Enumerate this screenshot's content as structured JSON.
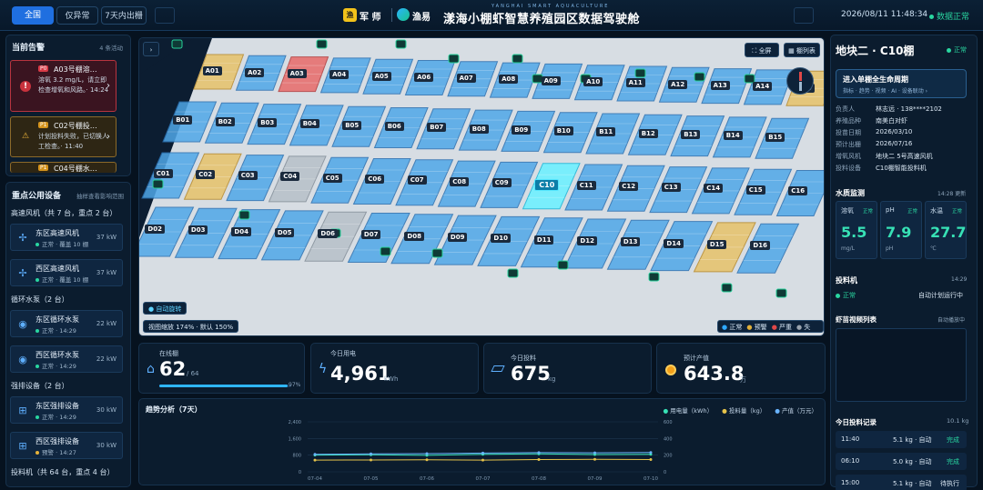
{
  "header": {
    "tabs": [
      "全国",
      "仅异常",
      "7天内出栅"
    ],
    "brand_left": "军 师",
    "brand_logo_char": "渔",
    "brand_right": "渔易",
    "title": "漾海小棚虾智慧养殖园区数据驾驶舱",
    "subtitle": "YANGHAI SMART AQUACULTURE",
    "datetime": "2026/08/11 11:48:34",
    "online": "数据正常"
  },
  "alerts": {
    "title": "当前告警",
    "count": "4 条活动",
    "items": [
      {
        "tag": "P0",
        "title": "A03号棚溶…",
        "body": "溶氧 3.2 mg/L，请立即检查增氧和风路。· 14:24",
        "icon": "!",
        "level": "critical"
      },
      {
        "tag": "P1",
        "title": "C02号棚投…",
        "body": "计划投料失败，已切换人工检查。· 11:40",
        "icon": "⚠",
        "level": "warning"
      },
      {
        "tag": "P1",
        "title": "C04号棚水…",
        "body": "",
        "icon": "⚠",
        "level": "warning"
      }
    ]
  },
  "equipment": {
    "title": "重点公用设备",
    "hint": "抽样查看影响范围",
    "groups": [
      {
        "label": "高速风机（共 7 台，重点 2 台）",
        "items": [
          {
            "name": "东区高速风机",
            "status": "正常 · 覆盖 10 棚",
            "power": "37 kW",
            "icon": "fan-icon",
            "glyph": "✢"
          },
          {
            "name": "西区高速风机",
            "status": "正常 · 覆盖 10 棚",
            "power": "37 kW",
            "icon": "fan-icon",
            "glyph": "✢"
          }
        ]
      },
      {
        "label": "循环水泵（2 台）",
        "items": [
          {
            "name": "东区循环水泵",
            "status": "正常 · 14:29",
            "power": "22 kW",
            "icon": "pump-icon",
            "glyph": "◉"
          },
          {
            "name": "西区循环水泵",
            "status": "正常 · 14:29",
            "power": "22 kW",
            "icon": "pump-icon",
            "glyph": "◉"
          }
        ]
      },
      {
        "label": "强排设备（2 台）",
        "items": [
          {
            "name": "东区强排设备",
            "status": "正常 · 14:29",
            "power": "30 kW",
            "icon": "exhaust-icon",
            "glyph": "⊞"
          },
          {
            "name": "西区强排设备",
            "status": "预警 · 14:27",
            "power": "30 kW",
            "icon": "exhaust-icon",
            "glyph": "⊞"
          }
        ]
      },
      {
        "label": "投料机（共 64 台，重点 4 台）",
        "items": [
          {
            "name": "C02棚投料机",
            "status": "预警 · 11:40",
            "power": "单棚",
            "icon": "feeder-icon",
            "glyph": "▣"
          }
        ]
      }
    ]
  },
  "map": {
    "btn_fullscreen": "全屏",
    "btn_list": "棚列表",
    "btn_expand": "›",
    "auto_rotate": "自动旋转",
    "zoom": "视图缩放 174% · 默认 150%",
    "legend": [
      {
        "label": "正常",
        "color": "#2ea8ff"
      },
      {
        "label": "预警",
        "color": "#e0b03a"
      },
      {
        "label": "严重",
        "color": "#e04848"
      },
      {
        "label": "失联",
        "color": "#9aa4ae"
      }
    ],
    "selected": "C10",
    "rows": [
      [
        "A01",
        "A02",
        "A03",
        "A04",
        "A05",
        "A06",
        "A07",
        "A08",
        "A09",
        "A10",
        "A11",
        "A12",
        "A13",
        "A14",
        "A15"
      ],
      [
        "B01",
        "B02",
        "B03",
        "B04",
        "B05",
        "B06",
        "B07",
        "B08",
        "B09",
        "B10",
        "B11",
        "B12",
        "B13",
        "B14",
        "B15"
      ],
      [
        "C01",
        "C02",
        "C03",
        "C04",
        "C05",
        "C06",
        "C07",
        "C08",
        "C09",
        "C10",
        "C11",
        "C12",
        "C13",
        "C14",
        "C15",
        "C16"
      ],
      [
        "D02",
        "D03",
        "D04",
        "D05",
        "D06",
        "D07",
        "D08",
        "D09",
        "D10",
        "D11",
        "D12",
        "D13",
        "D14",
        "D15",
        "D16"
      ]
    ],
    "status": {
      "A01": "warn",
      "A03": "crit",
      "C02": "warn",
      "C04": "offline",
      "D06": "offline",
      "D15": "warn",
      "A15": "warn"
    }
  },
  "stats": [
    {
      "label": "在线棚",
      "value": "62",
      "unit": "/ 64",
      "extra": "97%",
      "icon": "home-icon"
    },
    {
      "label": "今日用电",
      "value": "4,961",
      "unit": "kWh",
      "icon": "bolt-icon"
    },
    {
      "label": "今日投料",
      "value": "675",
      "unit": "kg",
      "icon": "feed-icon"
    },
    {
      "label": "预计产值",
      "value": "643.8",
      "unit": "万",
      "icon": "coin-icon"
    }
  ],
  "trend": {
    "title": "趋势分析（7天）",
    "legend": [
      {
        "label": "用电量（kWh）",
        "color": "#37e1b5"
      },
      {
        "label": "投料量（kg）",
        "color": "#e6c34a"
      },
      {
        "label": "产值（万元）",
        "color": "#6ab4ff"
      }
    ]
  },
  "chart_data": {
    "type": "line",
    "title": "趋势分析（7天）",
    "x": [
      "07-04",
      "07-05",
      "07-06",
      "07-07",
      "07-08",
      "07-09",
      "07-10"
    ],
    "ylim_left": [
      0,
      2400
    ],
    "ylim_right": [
      0,
      600
    ],
    "y_left_ticks": [
      "2,400",
      "1,600",
      "800",
      "0"
    ],
    "y_right_ticks": [
      "600",
      "400",
      "200",
      "0"
    ],
    "series": [
      {
        "name": "用电量（kWh）",
        "axis": "left",
        "color": "#37e1b5",
        "values": [
          800,
          820,
          790,
          840,
          860,
          830,
          840
        ]
      },
      {
        "name": "投料量（kg）",
        "axis": "left",
        "color": "#e6c34a",
        "values": [
          560,
          570,
          580,
          560,
          590,
          600,
          590
        ]
      },
      {
        "name": "产值（万元）",
        "axis": "right",
        "color": "#6ab4ff",
        "values": [
          210,
          215,
          218,
          225,
          230,
          228,
          232
        ]
      }
    ]
  },
  "right": {
    "title": "地块二 · C10棚",
    "status": "正常",
    "cycle_title": "进入单棚全生命周期",
    "cycle_sub": "指标 · 趋势 · 视频 · AI · 设备联动 ›",
    "info": [
      [
        "负责人",
        "林志远 · 138****2102"
      ],
      [
        "养殖品种",
        "南美白对虾"
      ],
      [
        "投苗日期",
        "2026/03/10"
      ],
      [
        "预计出栅",
        "2026/07/16"
      ],
      [
        "增氧风机",
        "地块二 5号高速风机"
      ],
      [
        "投料设备",
        "C10棚智能投料机"
      ]
    ],
    "wq_title": "水质监测",
    "wq_time": "14:28 更新",
    "wq": [
      {
        "label": "溶氧",
        "status": "正常",
        "value": "5.5",
        "unit": "mg/L"
      },
      {
        "label": "pH",
        "status": "正常",
        "value": "7.9",
        "unit": "pH"
      },
      {
        "label": "水温",
        "status": "正常",
        "value": "27.7",
        "unit": "℃"
      }
    ],
    "feed_title": "投料机",
    "feed_time": "14:29",
    "feed_status": "正常",
    "feed_plan": "自动计划运行中",
    "video_title": "虾苗视频列表",
    "video_hint": "自动播放中",
    "records_title": "今日投料记录",
    "records_total": "10.1 kg",
    "records": [
      {
        "time": "11:40",
        "amount": "5.1 kg · 自动",
        "state": "完成"
      },
      {
        "time": "06:10",
        "amount": "5.0 kg · 自动",
        "state": "完成"
      },
      {
        "time": "15:00",
        "amount": "5.1 kg · 自动",
        "state": "待执行"
      }
    ]
  }
}
